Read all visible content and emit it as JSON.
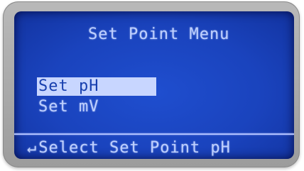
{
  "screen": {
    "title": "Set Point Menu",
    "menu_items": [
      {
        "label": "Set pH",
        "selected": true
      },
      {
        "label": "Set mV",
        "selected": false
      }
    ],
    "hint_icon": "↵",
    "hint_text": "Select Set Point pH"
  },
  "colors": {
    "lcd_background": "#1a43bd",
    "lcd_text": "#bfd0ff",
    "bezel": "#a9a9a9"
  }
}
